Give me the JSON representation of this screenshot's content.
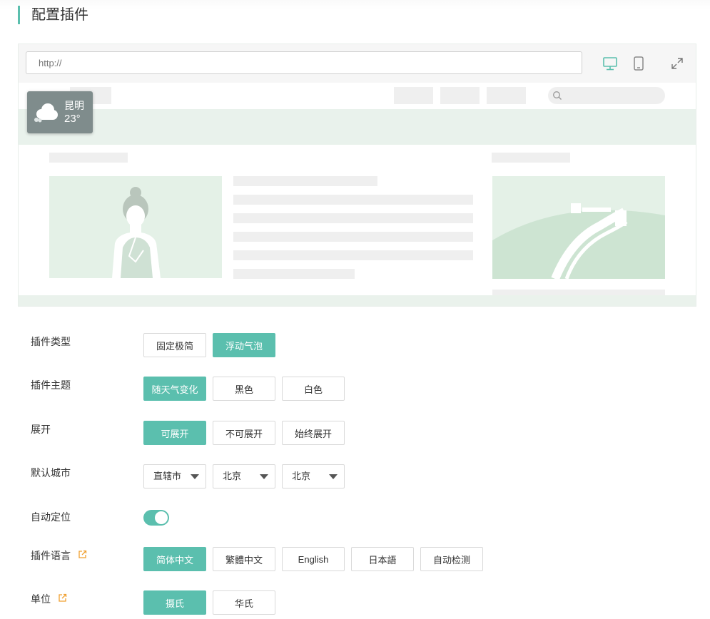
{
  "header": {
    "title": "配置插件"
  },
  "preview": {
    "url_placeholder": "http://",
    "weather_widget": {
      "city": "昆明",
      "temperature": "23°",
      "icon": "cloud-icon"
    },
    "device_icons": [
      "desktop-icon",
      "mobile-icon",
      "expand-icon"
    ]
  },
  "settings": {
    "plugin_type": {
      "label": "插件类型",
      "options": [
        "固定极简",
        "浮动气泡"
      ],
      "selected": "浮动气泡"
    },
    "plugin_theme": {
      "label": "插件主题",
      "options": [
        "随天气变化",
        "黑色",
        "白色"
      ],
      "selected": "随天气变化"
    },
    "expand": {
      "label": "展开",
      "options": [
        "可展开",
        "不可展开",
        "始终展开"
      ],
      "selected": "可展开"
    },
    "default_city": {
      "label": "默认城市",
      "selects": [
        "直辖市",
        "北京",
        "北京"
      ]
    },
    "auto_locate": {
      "label": "自动定位",
      "enabled": true
    },
    "language": {
      "label": "插件语言",
      "options": [
        "简体中文",
        "繁體中文",
        "English",
        "日本語",
        "自动检测"
      ],
      "selected": "简体中文"
    },
    "unit": {
      "label": "单位",
      "options": [
        "摄氏",
        "华氏"
      ],
      "selected": "摄氏"
    }
  },
  "colors": {
    "accent": "#5bbfae",
    "link_icon": "#f0a030",
    "preview_green": "#e4f1e7"
  }
}
